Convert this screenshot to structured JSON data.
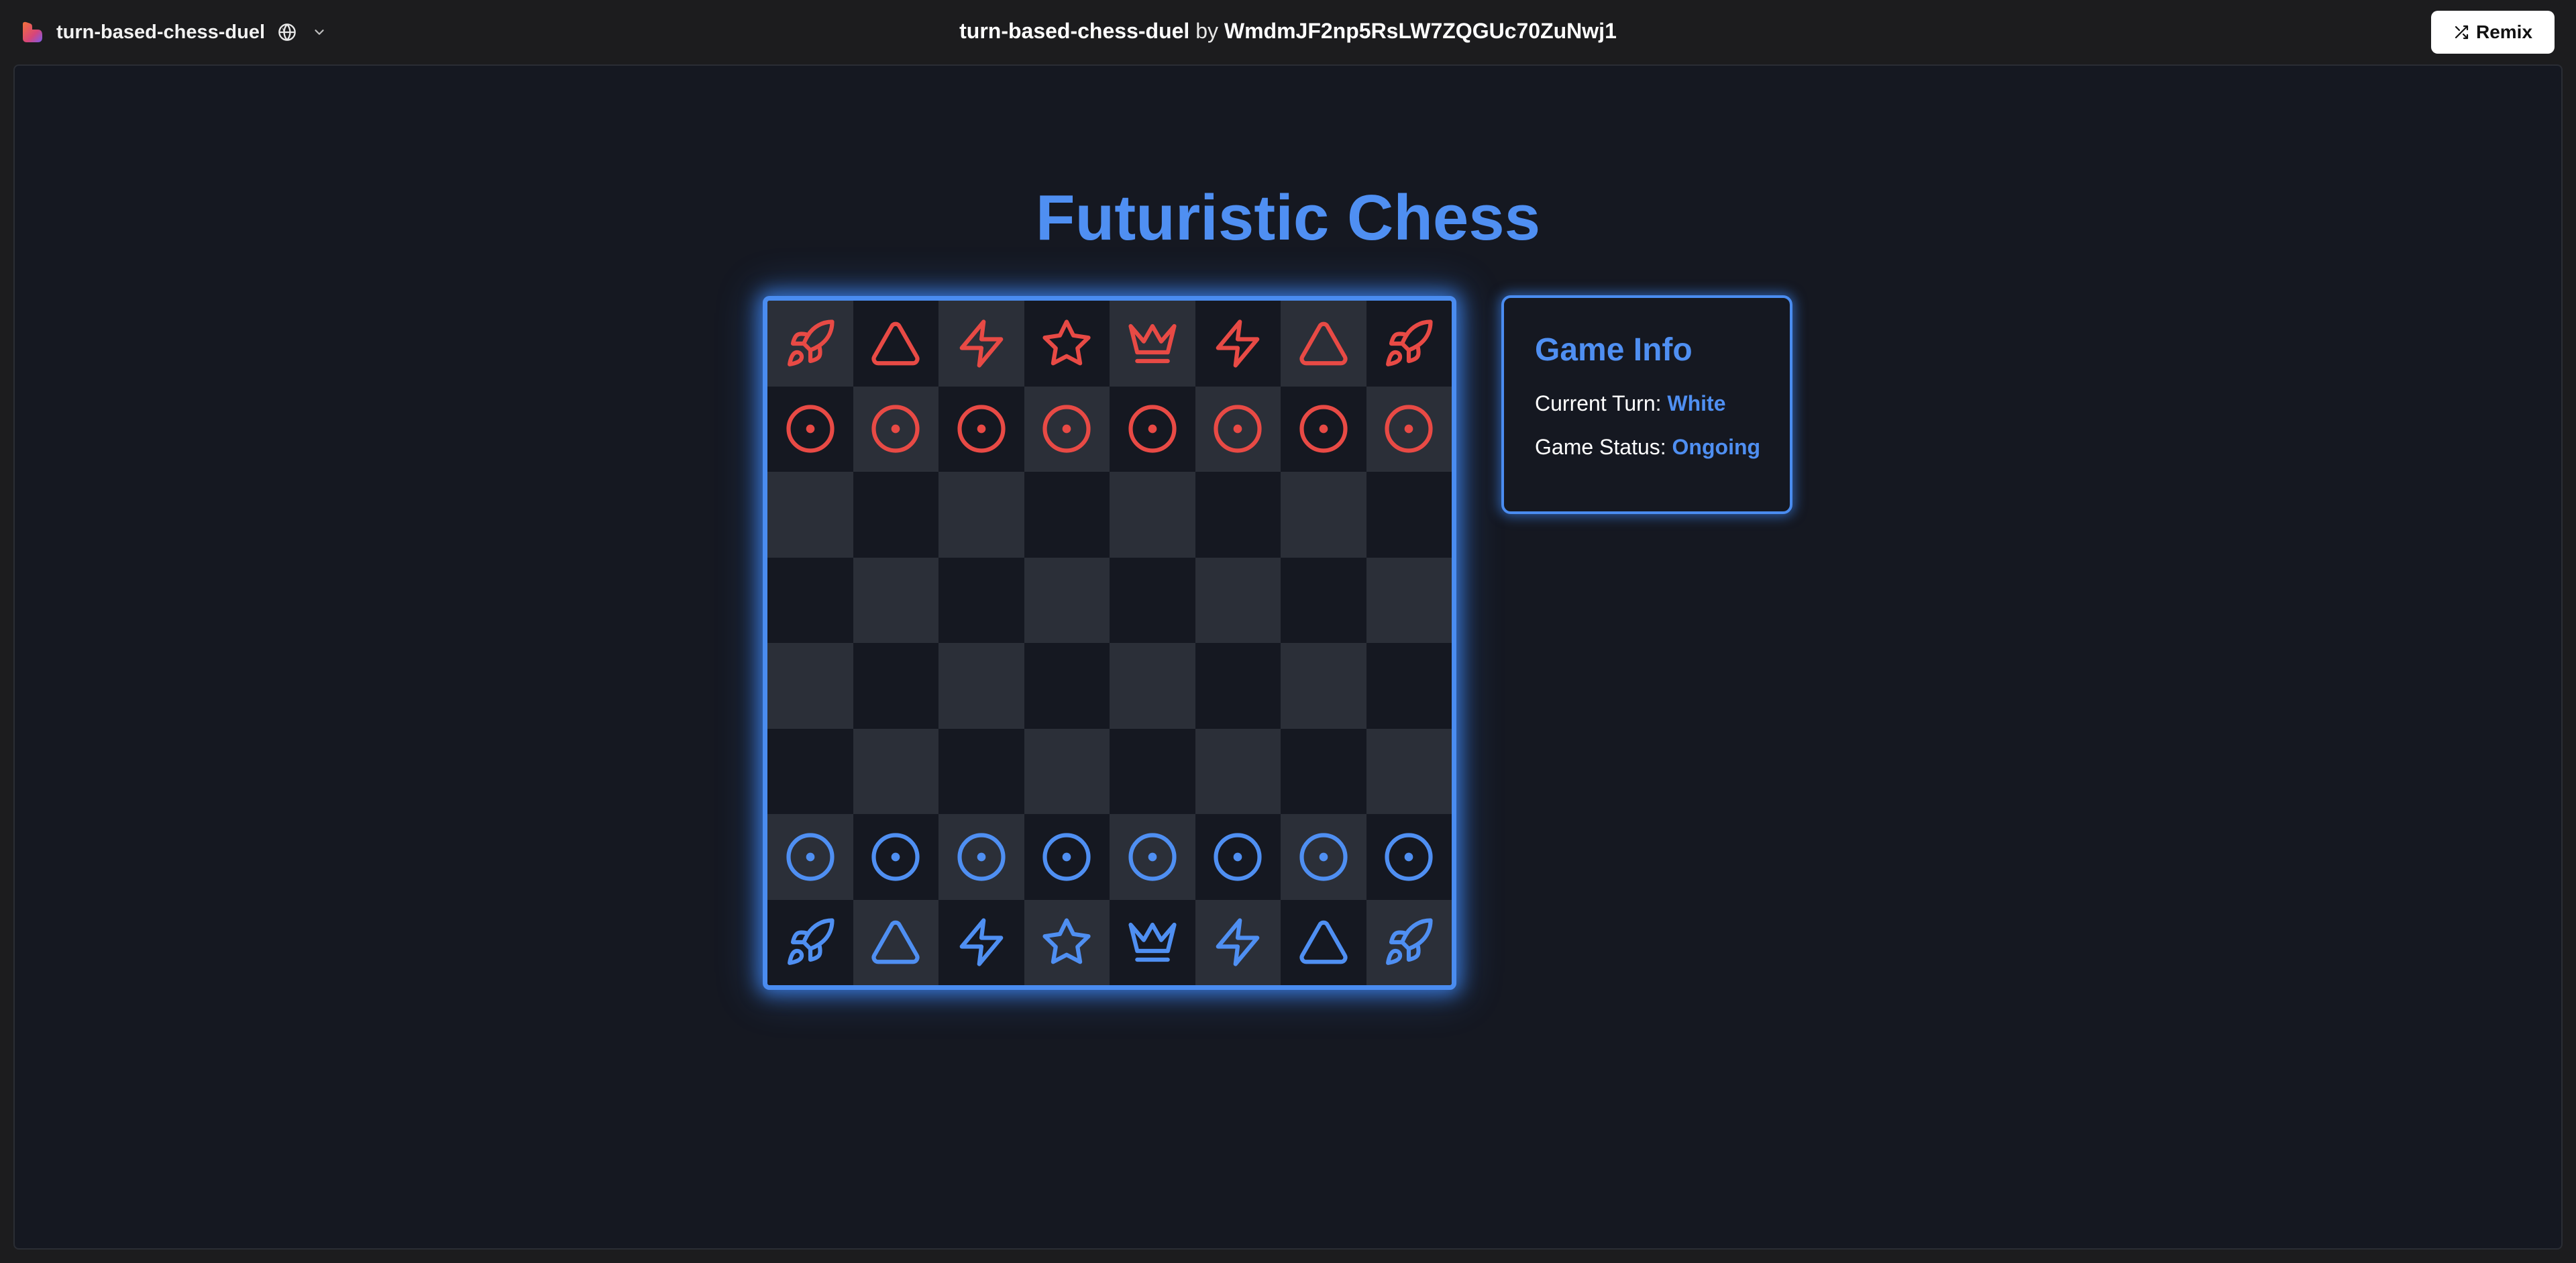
{
  "app": {
    "name": "turn-based-chess-duel",
    "title_project": "turn-based-chess-duel",
    "title_by": "by",
    "title_user": "WmdmJF2np5RsLW7ZQGUc70ZuNwj1",
    "remix_label": "Remix"
  },
  "game": {
    "title": "Futuristic Chess",
    "info": {
      "heading": "Game Info",
      "turn_label": "Current Turn:",
      "turn_value": "White",
      "status_label": "Game Status:",
      "status_value": "Ongoing"
    }
  },
  "colors": {
    "red_pieces": "#e84a45",
    "blue_pieces": "#4f8ff2",
    "light_square": "#2b2f38",
    "dark_square": "#151821",
    "accent": "#4f8ff2"
  },
  "board": {
    "rows": [
      [
        "rocket-red",
        "triangle-red",
        "zap-red",
        "star-red",
        "crown-red",
        "zap-red",
        "triangle-red",
        "rocket-red"
      ],
      [
        "pawn-red",
        "pawn-red",
        "pawn-red",
        "pawn-red",
        "pawn-red",
        "pawn-red",
        "pawn-red",
        "pawn-red"
      ],
      [
        "",
        "",
        "",
        "",
        "",
        "",
        "",
        ""
      ],
      [
        "",
        "",
        "",
        "",
        "",
        "",
        "",
        ""
      ],
      [
        "",
        "",
        "",
        "",
        "",
        "",
        "",
        ""
      ],
      [
        "",
        "",
        "",
        "",
        "",
        "",
        "",
        ""
      ],
      [
        "pawn-blue",
        "pawn-blue",
        "pawn-blue",
        "pawn-blue",
        "pawn-blue",
        "pawn-blue",
        "pawn-blue",
        "pawn-blue"
      ],
      [
        "rocket-blue",
        "triangle-blue",
        "zap-blue",
        "star-blue",
        "crown-blue",
        "zap-blue",
        "triangle-blue",
        "rocket-blue"
      ]
    ]
  }
}
